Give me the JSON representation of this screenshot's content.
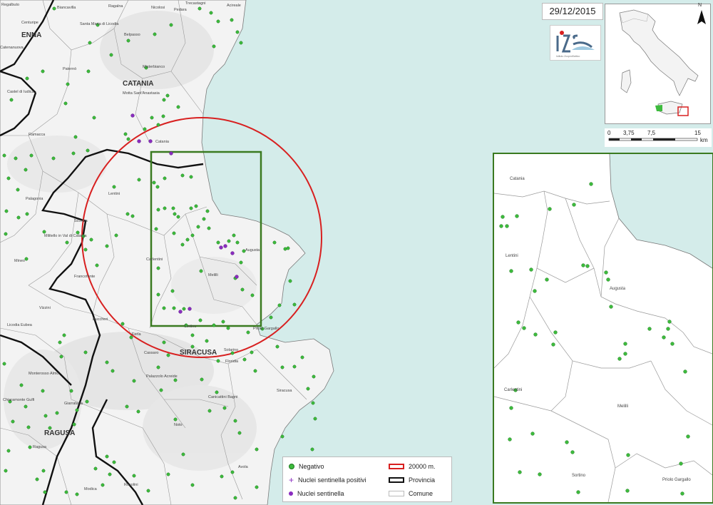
{
  "date": "29/12/2015",
  "colors": {
    "sea": "#d4ecea",
    "land": "#f3f3f3",
    "negative": "#3dbb3d",
    "positive": "#8a2cc0",
    "sentinel": "#8a2cc0",
    "buffer": "#d82020",
    "detail_frame": "#3a7a20",
    "province_border": "#111111"
  },
  "map_labels": {
    "enna": "ENNA",
    "catania": "CATANIA",
    "siracusa": "SIRACUSA",
    "ragusa": "RAGUSA"
  },
  "small_labels": {
    "adrano": "Regalbuto",
    "biancavilla": "Biancavilla",
    "ragalna": "Ragalna",
    "nicolosi": "Nicolosi",
    "pedara": "Pedara",
    "trecastagni": "Trecastagni",
    "acireale": "Acireale",
    "centuripe": "Centuripe",
    "santa_maria": "Santa Maria di Licodia",
    "belpasso": "Belpasso",
    "catenanuova": "Catenanuova",
    "paterno": "Paternò",
    "misterbianco": "Misterbianco",
    "motta": "Motta Sant'Anastasia",
    "castel_iudica": "Castel di Iudica",
    "ramacca": "Ramacca",
    "catania_s": "Catania",
    "lentini": "Lentini",
    "palagonia": "Palagonia",
    "scordia": "Scordia",
    "militello": "Militello in Val di Catania",
    "mineo": "Mineo",
    "francofonte": "Francofonte",
    "carlentini": "Carlentini",
    "melilli": "Melilli",
    "augusta": "Augusta",
    "vizzini": "Vizzini",
    "licodia": "Licodia Eubea",
    "buccheri": "Buccheri",
    "ferla": "Ferla",
    "cassaro": "Cassaro",
    "sortino": "Sortino",
    "priolo": "Priolo Gargallo",
    "floridia": "Floridia",
    "solarino": "Solarino",
    "siracusa_s": "Siracusa",
    "palazzolo": "Palazzolo Acreide",
    "canicattini": "Canicattini Bagni",
    "noto": "Noto",
    "avola": "Avola",
    "monterosso": "Monterosso Almo",
    "chiaramonte": "Chiaramonte Gulfi",
    "giarratana": "Giarratana",
    "ragusa_s": "Ragusa",
    "modica": "Modica",
    "rosolini": "Rosolini"
  },
  "detail_labels": {
    "catania": "Catania",
    "lentini": "Lentini",
    "augusta": "Augusta",
    "carlentini": "Carlentini",
    "melilli": "Melilli",
    "sortino": "Sortino",
    "priolo": "Priolo Gargallo"
  },
  "scalebar": {
    "ticks": [
      "0",
      "3,75",
      "7,5",
      "15"
    ],
    "unit": "km"
  },
  "north": "N",
  "legend": {
    "negative": "Negativo",
    "positive": "Nuclei sentinella positivi",
    "sentinel": "Nuclei sentinella",
    "buffer": "20000 m.",
    "province": "Provincia",
    "comune": "Comune"
  }
}
